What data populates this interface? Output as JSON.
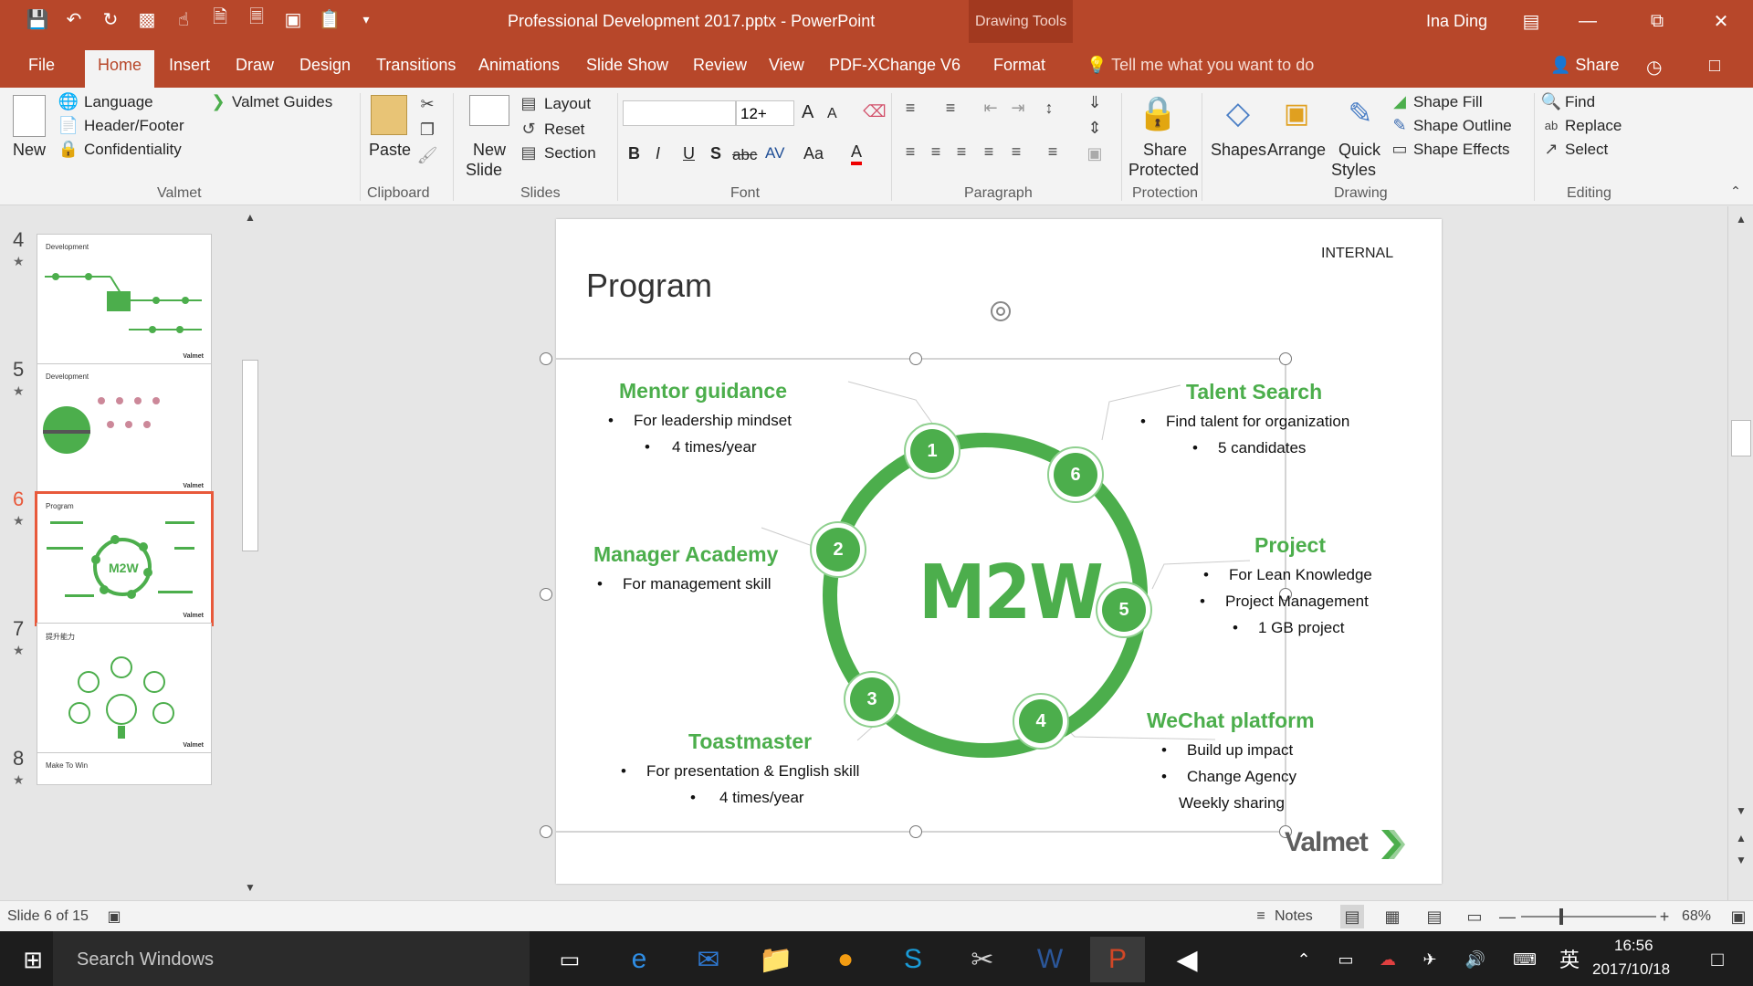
{
  "title_bar": {
    "document_title": "Professional Development 2017.pptx  -  PowerPoint",
    "drawing_tools": "Drawing Tools",
    "user_name": "Ina Ding",
    "qat_icons": [
      "save-icon",
      "undo-icon",
      "redo-icon",
      "present-icon",
      "touch-mode-icon",
      "pdf-icon",
      "pdf-convert-icon",
      "pdf-image-icon",
      "pdf-clipboard-icon",
      "customize-icon"
    ]
  },
  "tabs": [
    {
      "label": "File"
    },
    {
      "label": "Home",
      "active": true
    },
    {
      "label": "Insert"
    },
    {
      "label": "Draw"
    },
    {
      "label": "Design"
    },
    {
      "label": "Transitions"
    },
    {
      "label": "Animations"
    },
    {
      "label": "Slide Show"
    },
    {
      "label": "Review"
    },
    {
      "label": "View"
    },
    {
      "label": "PDF-XChange V6"
    },
    {
      "label": "Format"
    }
  ],
  "tell_me": "Tell me what you want to do",
  "share": "Share",
  "ribbon": {
    "valmet": {
      "new": "New",
      "language": "Language",
      "header_footer": "Header/Footer",
      "confidentiality": "Confidentiality",
      "guides": "Valmet Guides",
      "group": "Valmet"
    },
    "clipboard": {
      "paste": "Paste",
      "group": "Clipboard"
    },
    "slides": {
      "new_slide_1": "New",
      "new_slide_2": "Slide",
      "layout": "Layout",
      "reset": "Reset",
      "section": "Section",
      "group": "Slides"
    },
    "font": {
      "font_name": "",
      "font_size": "12+",
      "bold": "B",
      "italic": "I",
      "underline": "U",
      "shadow": "S",
      "strike": "abc",
      "spacing": "AV",
      "case": "Aa",
      "color": "A",
      "grow": "A",
      "shrink": "A",
      "group": "Font"
    },
    "paragraph": {
      "group": "Paragraph"
    },
    "protection": {
      "share_protected_1": "Share",
      "share_protected_2": "Protected",
      "group": "Protection"
    },
    "drawing": {
      "shapes": "Shapes",
      "arrange": "Arrange",
      "quick_styles_1": "Quick",
      "quick_styles_2": "Styles",
      "shape_fill": "Shape Fill",
      "shape_outline": "Shape Outline",
      "shape_effects": "Shape Effects",
      "group": "Drawing"
    },
    "editing": {
      "find": "Find",
      "replace": "Replace",
      "select": "Select",
      "group": "Editing"
    }
  },
  "thumbnails": [
    {
      "number": "4",
      "title": "Development"
    },
    {
      "number": "5",
      "title": "Development"
    },
    {
      "number": "6",
      "title": "Program",
      "active": true
    },
    {
      "number": "7",
      "title": "提升能力"
    },
    {
      "number": "8",
      "title": "Make To Win"
    }
  ],
  "slide": {
    "title": "Program",
    "tag": "INTERNAL",
    "logo": "Valmet",
    "center": "M2W",
    "nodes": [
      "1",
      "2",
      "3",
      "4",
      "5",
      "6"
    ],
    "sections": {
      "mentor": {
        "title": "Mentor guidance",
        "b1": "For leadership mindset",
        "b2": "4 times/year"
      },
      "talent": {
        "title": "Talent Search",
        "b1": "Find talent for organization",
        "b2": "5 candidates"
      },
      "manager": {
        "title": "Manager Academy",
        "b1": "For management skill"
      },
      "project": {
        "title": "Project",
        "b1": "For Lean Knowledge",
        "b2": "Project Management",
        "b3": "1 GB project"
      },
      "toast": {
        "title": "Toastmaster",
        "b1": "For presentation & English skill",
        "b2": "4 times/year"
      },
      "wechat": {
        "title": "WeChat platform",
        "b1": "Build up impact",
        "b2": "Change Agency",
        "b3": "Weekly sharing"
      }
    },
    "bullet_char": "•"
  },
  "status": {
    "slide_count": "Slide 6 of 15",
    "notes": "Notes",
    "zoom": "68%"
  },
  "taskbar": {
    "search": "Search Windows",
    "time": "16:56",
    "date": "2017/10/18",
    "ime": "英"
  },
  "colors": {
    "accent": "#b7472a",
    "green": "#4cae4c"
  }
}
